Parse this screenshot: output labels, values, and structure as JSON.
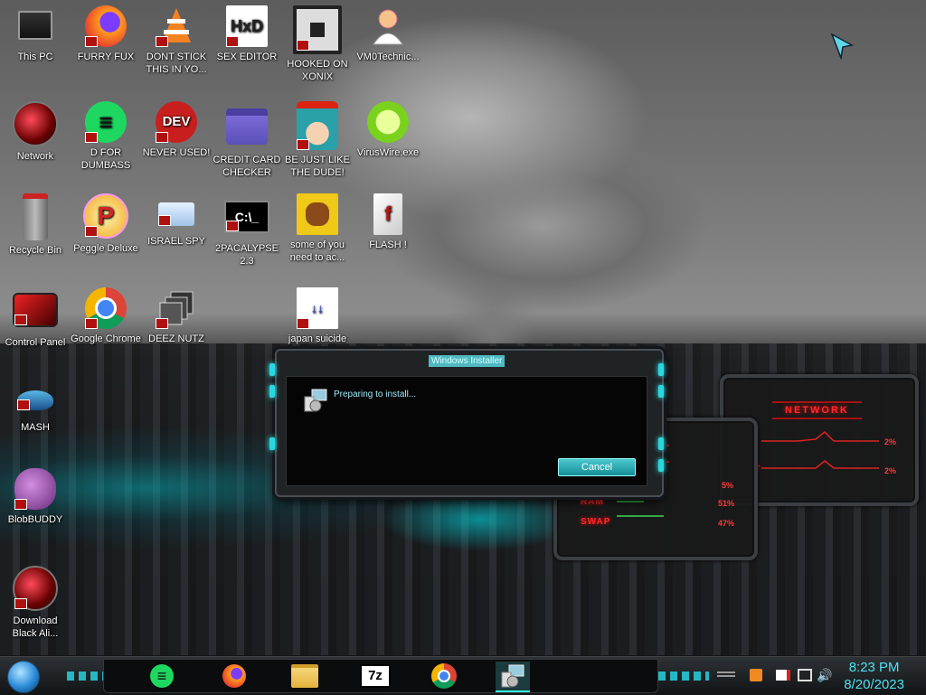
{
  "desktop": {
    "icons": [
      {
        "label": "This PC",
        "icon": "monitor-icon"
      },
      {
        "label": "FURRY FUX",
        "icon": "firefox-icon"
      },
      {
        "label": "DONT STICK THIS IN YO...",
        "icon": "vlc-cone-icon"
      },
      {
        "label": "SEX EDITOR",
        "icon": "hxd-editor-icon"
      },
      {
        "label": "HOOKED ON XONIX",
        "icon": "xonix-game-icon"
      },
      {
        "label": "VM0Technic...",
        "icon": "doctor-avatar-icon"
      },
      {
        "label": "Network",
        "icon": "red-globe-icon"
      },
      {
        "label": "D FOR DUMBASS",
        "icon": "green-chat-icon"
      },
      {
        "label": "NEVER USED!",
        "icon": "devcpp-icon"
      },
      {
        "label": "CREDIT CARD CHECKER",
        "icon": "credit-card-icon"
      },
      {
        "label": "BE JUST LIKE THE DUDE!",
        "icon": "elf-santa-icon"
      },
      {
        "label": "VirusWire.exe",
        "icon": "lime-icon"
      },
      {
        "label": "Recycle Bin",
        "icon": "recycle-bin-icon"
      },
      {
        "label": "Peggle Deluxe",
        "icon": "peggle-icon"
      },
      {
        "label": "ISRAEL SPY",
        "icon": "network-computer-icon"
      },
      {
        "label": "2PACALYPSE 2.3",
        "icon": "terminal-icon"
      },
      {
        "label": "some of you need to ac...",
        "icon": "dog-icon"
      },
      {
        "label": "FLASH !",
        "icon": "flash-doc-icon"
      },
      {
        "label": "Control Panel",
        "icon": "control-panel-icon"
      },
      {
        "label": "Google Chrome",
        "icon": "chrome-icon"
      },
      {
        "label": "DEEZ NUTZ",
        "icon": "stacked-windows-icon"
      },
      {
        "label": "japan suicide",
        "icon": "document-icon"
      },
      {
        "label": "MASH",
        "icon": "ufo-icon"
      },
      {
        "label": "BlobBUDDY",
        "icon": "purple-blob-icon"
      },
      {
        "label": "Download Black Ali...",
        "icon": "red-globe-icon"
      }
    ]
  },
  "installer": {
    "title": "Windows Installer",
    "message": "Preparing to install...",
    "cancel_label": "Cancel"
  },
  "network_widget": {
    "title": "NETWORK",
    "rows": [
      {
        "label": "",
        "value": "2%"
      },
      {
        "label": "T",
        "value": "2%"
      }
    ]
  },
  "system_widget": {
    "title_fragment": "em",
    "rows": [
      {
        "label": "",
        "value": "5%"
      },
      {
        "label": "RAM",
        "value": "51%"
      },
      {
        "label": "SWAP",
        "value": "47%"
      }
    ]
  },
  "taskbar": {
    "apps": [
      "green-chat-icon",
      "firefox-icon",
      "file-explorer-icon",
      "7zip-icon",
      "chrome-icon",
      "installer-icon"
    ],
    "zip_label": "7z",
    "time": "8:23 PM",
    "date": "8/20/2023"
  },
  "colors": {
    "accent": "#28d7e0",
    "widget_red": "#ff2a2a"
  }
}
